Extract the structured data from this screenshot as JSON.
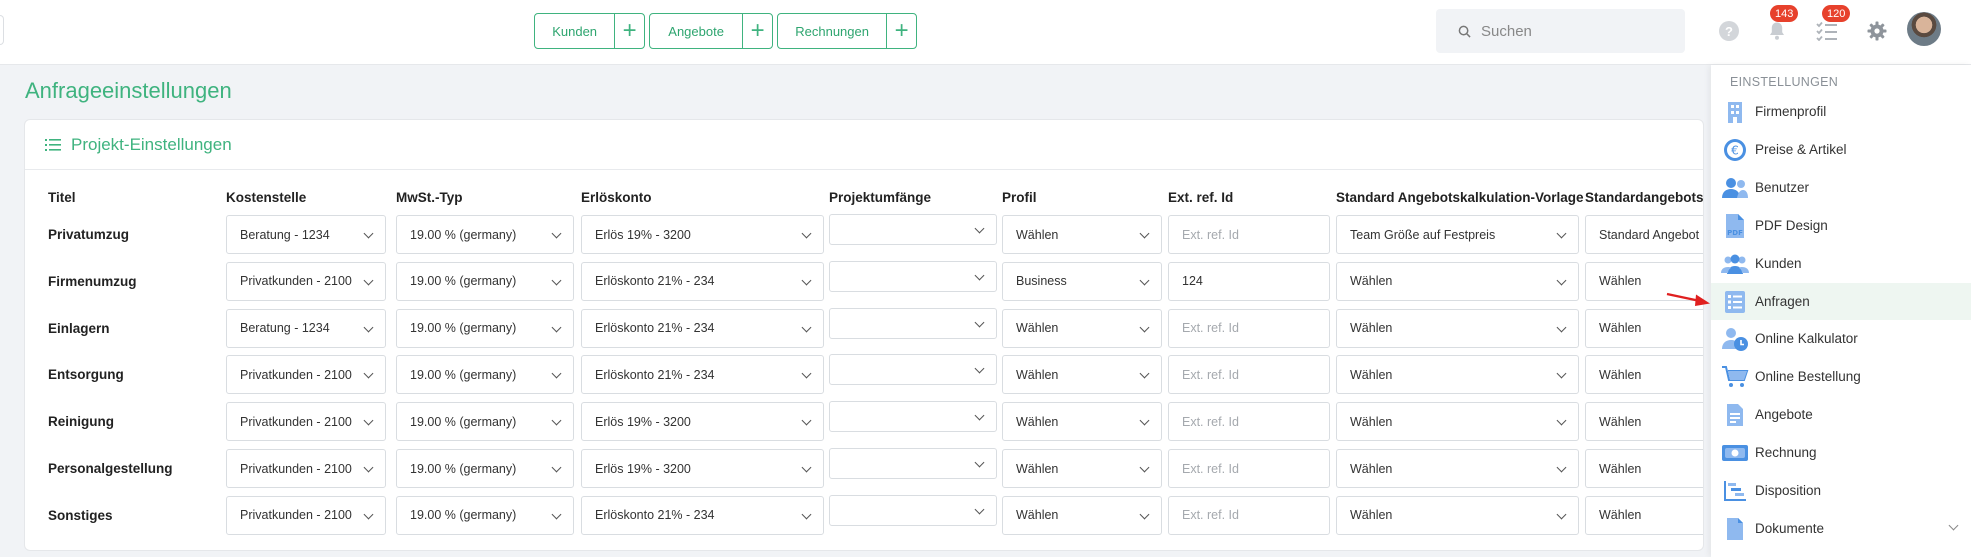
{
  "topbar": {
    "quick_buttons": [
      {
        "label": "Kunden"
      },
      {
        "label": "Angebote"
      },
      {
        "label": "Rechnungen"
      }
    ],
    "plus_symbol": "+",
    "search_placeholder": "Suchen",
    "help_symbol": "?",
    "notifications_count": "143",
    "tasks_count": "120"
  },
  "page": {
    "title": "Anfrageeinstellungen",
    "card_title": "Projekt-Einstellungen"
  },
  "table": {
    "headers": [
      "Titel",
      "Kostenstelle",
      "MwSt.-Typ",
      "Erlöskonto",
      "Projektumfänge",
      "Profil",
      "Ext. ref. Id",
      "Standard Angebotskalkulation-Vorlage",
      "Standardangebotstext"
    ],
    "ext_placeholder": "Ext. ref. Id",
    "rows": [
      {
        "title": "Privatumzug",
        "kostenstelle": "Beratung - 1234",
        "mwst": "19.00 % (germany)",
        "erloeskonto": "Erlös 19% - 3200",
        "projektumfaenge": "",
        "profil": "Wählen",
        "ext_ref": "",
        "vorlage": "Team Größe auf Festpreis",
        "text": "Standard Angebot"
      },
      {
        "title": "Firmenumzug",
        "kostenstelle": "Privatkunden - 2100",
        "mwst": "19.00 % (germany)",
        "erloeskonto": "Erlöskonto 21% - 234",
        "projektumfaenge": "",
        "profil": "Business",
        "ext_ref": "124",
        "vorlage": "Wählen",
        "text": "Wählen"
      },
      {
        "title": "Einlagern",
        "kostenstelle": "Beratung - 1234",
        "mwst": "19.00 % (germany)",
        "erloeskonto": "Erlöskonto 21% - 234",
        "projektumfaenge": "",
        "profil": "Wählen",
        "ext_ref": "",
        "vorlage": "Wählen",
        "text": "Wählen"
      },
      {
        "title": "Entsorgung",
        "kostenstelle": "Privatkunden - 2100",
        "mwst": "19.00 % (germany)",
        "erloeskonto": "Erlöskonto 21% - 234",
        "projektumfaenge": "",
        "profil": "Wählen",
        "ext_ref": "",
        "vorlage": "Wählen",
        "text": "Wählen"
      },
      {
        "title": "Reinigung",
        "kostenstelle": "Privatkunden - 2100",
        "mwst": "19.00 % (germany)",
        "erloeskonto": "Erlös 19% - 3200",
        "projektumfaenge": "",
        "profil": "Wählen",
        "ext_ref": "",
        "vorlage": "Wählen",
        "text": "Wählen"
      },
      {
        "title": "Personalgestellung",
        "kostenstelle": "Privatkunden - 2100",
        "mwst": "19.00 % (germany)",
        "erloeskonto": "Erlös 19% - 3200",
        "projektumfaenge": "",
        "profil": "Wählen",
        "ext_ref": "",
        "vorlage": "Wählen",
        "text": "Wählen"
      },
      {
        "title": "Sonstiges",
        "kostenstelle": "Privatkunden - 2100",
        "mwst": "19.00 % (germany)",
        "erloeskonto": "Erlöskonto 21% - 234",
        "projektumfaenge": "",
        "profil": "Wählen",
        "ext_ref": "",
        "vorlage": "Wählen",
        "text": "Wählen"
      }
    ]
  },
  "sidebar": {
    "title": "EINSTELLUNGEN",
    "items": [
      {
        "label": "Firmenprofil",
        "icon": "building-icon"
      },
      {
        "label": "Preise & Artikel",
        "icon": "euro-icon"
      },
      {
        "label": "Benutzer",
        "icon": "users-icon"
      },
      {
        "label": "PDF Design",
        "icon": "pdf-icon"
      },
      {
        "label": "Kunden",
        "icon": "customers-icon"
      },
      {
        "label": "Anfragen",
        "icon": "list-icon",
        "active": true
      },
      {
        "label": "Online Kalkulator",
        "icon": "user-clock-icon"
      },
      {
        "label": "Online Bestellung",
        "icon": "cart-icon"
      },
      {
        "label": "Angebote",
        "icon": "document-icon"
      },
      {
        "label": "Rechnung",
        "icon": "money-icon"
      },
      {
        "label": "Disposition",
        "icon": "gantt-icon"
      },
      {
        "label": "Dokumente",
        "icon": "file-icon"
      }
    ]
  },
  "colors": {
    "accent": "#3fb37f",
    "badge": "#e7412c",
    "sidebar_icon": "#4a90e2",
    "arrow": "#e02020"
  }
}
